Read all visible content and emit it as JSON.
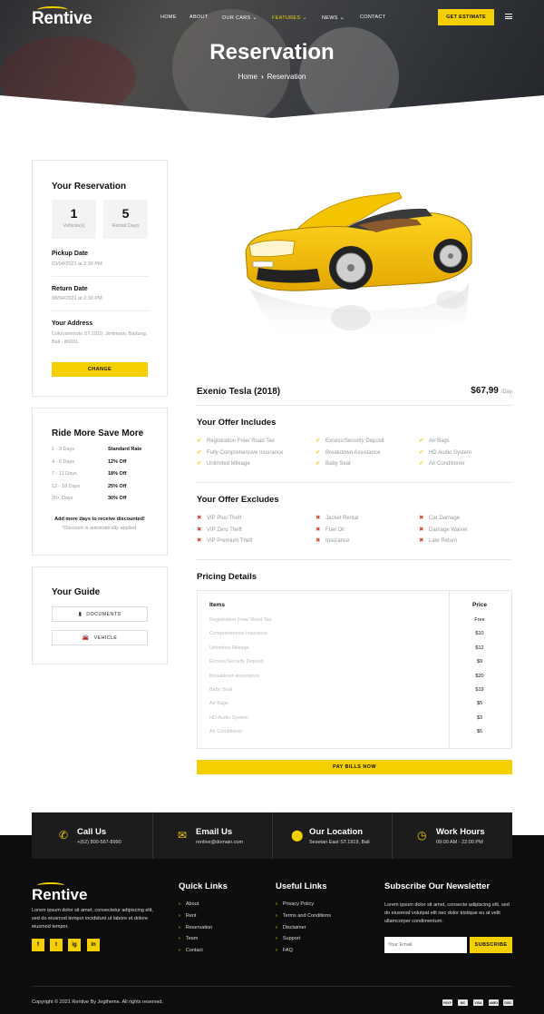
{
  "header": {
    "logo": "Rentive",
    "nav": [
      {
        "label": "HOME",
        "dropdown": false,
        "active": false
      },
      {
        "label": "ABOUT",
        "dropdown": false,
        "active": false
      },
      {
        "label": "OUR CARS",
        "dropdown": true,
        "active": false
      },
      {
        "label": "FEATURES",
        "dropdown": true,
        "active": true
      },
      {
        "label": "NEWS",
        "dropdown": true,
        "active": false
      },
      {
        "label": "CONTACT",
        "dropdown": false,
        "active": false
      }
    ],
    "cta_label": "GET ESTIMATE",
    "accent_color": "#f5d000"
  },
  "hero": {
    "title": "Reservation",
    "breadcrumb": [
      "Home",
      "Reservation"
    ]
  },
  "reservation": {
    "title": "Your Reservation",
    "vehicles": {
      "value": "1",
      "label": "Vehicle(s)"
    },
    "rental_days": {
      "value": "5",
      "label": "Rental Days"
    },
    "pickup": {
      "label": "Pickup Date",
      "value": "03/04/2021 at 2:30 PM"
    },
    "return": {
      "label": "Return Date",
      "value": "08/04/2021 at 2:30 PM"
    },
    "address": {
      "label": "Your Address",
      "value": "Cokroaminoto ST.1919, Jimbaran, Badung, Bali - 86001"
    },
    "change_label": "CHANGE"
  },
  "ride_more": {
    "title": "Ride More Save More",
    "rows": [
      {
        "days": "1 - 3 Days",
        "price": "Standard Rate"
      },
      {
        "days": "4 - 6 Days",
        "price": "12% Off"
      },
      {
        "days": "7 - 11 Days",
        "price": "18% Off"
      },
      {
        "days": "12 - 18 Days",
        "price": "25% Off"
      },
      {
        "days": "20+ Days",
        "price": "30% Off"
      }
    ],
    "note": "Add more days to receive discounted!",
    "subnote": "*Discount is automatically applied."
  },
  "guide": {
    "title": "Your Guide",
    "buttons": [
      {
        "label": "DOCUMENTS",
        "icon": "document-icon"
      },
      {
        "label": "VEHICLE",
        "icon": "car-icon"
      }
    ]
  },
  "car": {
    "name": "Exenio Tesla (2018)",
    "price": "$67,99",
    "unit": "/Day",
    "body_color": "#f5c400"
  },
  "includes": {
    "title": "Your Offer Includes",
    "items": [
      "Registration Free/ Road Tax",
      "Excess/Security Deposit",
      "Air Bags",
      "Fully Comprehensive Insurance",
      "Breakdown Assistance",
      "HD Audio System",
      "Unlimited Mileage",
      "Baby Seat",
      "Air Conditioner"
    ]
  },
  "excludes": {
    "title": "Your Offer Excludes",
    "items": [
      "VIP Plus Theft",
      "Jacket Rental",
      "Car Damage",
      "VIP Zero Theft",
      "Fuel Oil",
      "Damage Waiver",
      "VIP Premium Theft",
      "Insurance",
      "Late Return"
    ]
  },
  "pricing": {
    "title": "Pricing Details",
    "headers": [
      "Items",
      "Price"
    ],
    "rows": [
      {
        "item": "Registration Free/ Road Tax",
        "price": "Free"
      },
      {
        "item": "Comprehensive Insurance",
        "price": "$10"
      },
      {
        "item": "Unlimited Mileage",
        "price": "$12"
      },
      {
        "item": "Excess/Security Deposit",
        "price": "$9"
      },
      {
        "item": "Breakdown Assistance",
        "price": "$20"
      },
      {
        "item": "Baby Seat",
        "price": "$19"
      },
      {
        "item": "Air Bags",
        "price": "$5"
      },
      {
        "item": "HD Audio System",
        "price": "$3"
      },
      {
        "item": "Air Conditioner",
        "price": "$5"
      }
    ],
    "pay_label": "PAY BILLS NOW"
  },
  "contact_bar": [
    {
      "title": "Call Us",
      "sub": "+(62) 800-567-8990",
      "icon": "phone-icon"
    },
    {
      "title": "Email Us",
      "sub": "rentive@domain.com",
      "icon": "envelope-icon"
    },
    {
      "title": "Our Location",
      "sub": "Sesetan East ST.1919, Bali",
      "icon": "map-pin-icon"
    },
    {
      "title": "Work Hours",
      "sub": "09:00 AM - 22:00 PM",
      "icon": "clock-icon"
    }
  ],
  "footer": {
    "logo": "Rentive",
    "about": "Lorem ipsum dolor sit amet, consectetur adipiscing elit, sed do eiusmod tempor incididunt ut labore et dolore eiusmod tempor.",
    "social": [
      "f",
      "t",
      "ig",
      "in"
    ],
    "quick_links": {
      "title": "Quick Links",
      "items": [
        "About",
        "Rent",
        "Reservation",
        "Team",
        "Contact"
      ]
    },
    "useful_links": {
      "title": "Useful Links",
      "items": [
        "Privacy Policy",
        "Terms and Conditions",
        "Disclaimer",
        "Support",
        "FAQ"
      ]
    },
    "newsletter": {
      "title": "Subscribe Our Newsletter",
      "text": "Lorem ipsum dolor sit amet, consecte adipiscing elit, sed do eiusmod volutpat elit nec dolor tristique eu at velit ullamcorper condimentum.",
      "placeholder": "Your Email",
      "button": "SUBSCRIBE"
    },
    "copyright": "Copyright © 2021 Rentive By Jegtheme. All rights reserved.",
    "payments": [
      "paypal",
      "mc",
      "visa",
      "amex",
      "disc"
    ]
  }
}
